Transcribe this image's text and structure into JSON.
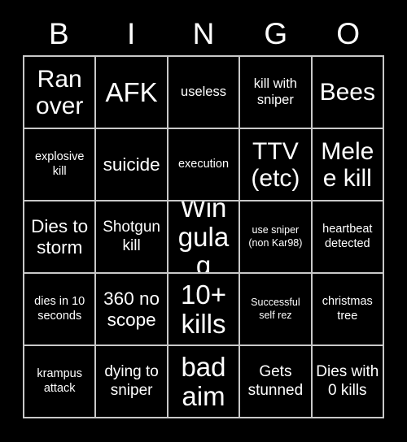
{
  "card": {
    "background_color": "#000000",
    "text_color": "#ffffff",
    "border_color": "#c8c8c8"
  },
  "header": {
    "letters": [
      "B",
      "I",
      "N",
      "G",
      "O"
    ]
  },
  "grid": {
    "columns": 5,
    "rows": 5,
    "cells": [
      {
        "text": "Ran over",
        "size": "fs-xl"
      },
      {
        "text": "AFK",
        "size": "fs-xxl"
      },
      {
        "text": "useless",
        "size": "fs-sm"
      },
      {
        "text": "kill with sniper",
        "size": "fs-sm"
      },
      {
        "text": "Bees",
        "size": "fs-xl"
      },
      {
        "text": "explosive kill",
        "size": "fs-s"
      },
      {
        "text": "suicide",
        "size": "fs-ml"
      },
      {
        "text": "execution",
        "size": "fs-s"
      },
      {
        "text": "TTV (etc)",
        "size": "fs-xl"
      },
      {
        "text": "Melee kill",
        "size": "fs-xl"
      },
      {
        "text": "Dies to storm",
        "size": "fs-ml"
      },
      {
        "text": "Shotgun kill",
        "size": "fs-m"
      },
      {
        "text": "Win gulag",
        "size": "fs-xxl"
      },
      {
        "text": "use sniper (non Kar98)",
        "size": "fs-xs"
      },
      {
        "text": "heartbeat detected",
        "size": "fs-s"
      },
      {
        "text": "dies in 10 seconds",
        "size": "fs-s"
      },
      {
        "text": "360 no scope",
        "size": "fs-ml"
      },
      {
        "text": "10+ kills",
        "size": "fs-xxl"
      },
      {
        "text": "Successful self rez",
        "size": "fs-xs"
      },
      {
        "text": "christmas tree",
        "size": "fs-s"
      },
      {
        "text": "krampus attack",
        "size": "fs-s"
      },
      {
        "text": "dying to sniper",
        "size": "fs-m"
      },
      {
        "text": "bad aim",
        "size": "fs-xxl"
      },
      {
        "text": "Gets stunned",
        "size": "fs-m"
      },
      {
        "text": "Dies with 0 kills",
        "size": "fs-m"
      }
    ]
  }
}
